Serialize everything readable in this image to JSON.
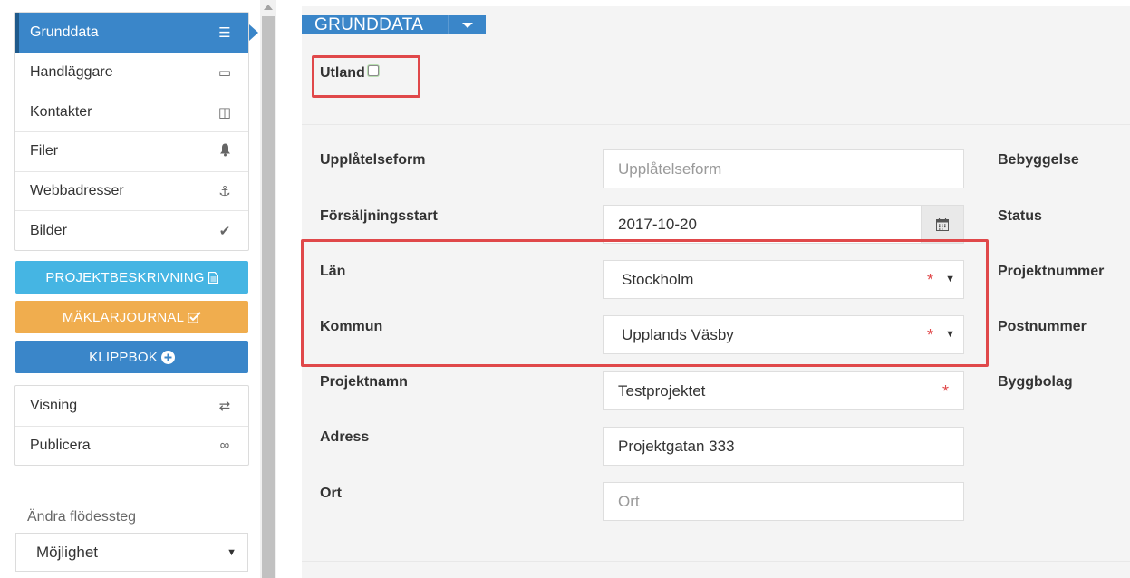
{
  "sidebar": {
    "items": [
      {
        "label": "Grunddata",
        "icon": "list-icon",
        "glyph": "☰"
      },
      {
        "label": "Handläggare",
        "icon": "laptop-icon",
        "glyph": "▭"
      },
      {
        "label": "Kontakter",
        "icon": "columns-icon",
        "glyph": "◫"
      },
      {
        "label": "Filer",
        "icon": "bell-icon",
        "glyph": "🔔"
      },
      {
        "label": "Webbadresser",
        "icon": "anchor-icon",
        "glyph": "⚓"
      },
      {
        "label": "Bilder",
        "icon": "check-icon",
        "glyph": "✔"
      }
    ],
    "buttons": {
      "projektbeskrivning": "PROJEKTBESKRIVNING",
      "maklarjournal": "MÄKLARJOURNAL",
      "klippbok": "KLIPPBOK"
    },
    "items2": [
      {
        "label": "Visning",
        "icon": "exchange-icon",
        "glyph": "⇄"
      },
      {
        "label": "Publicera",
        "icon": "link-icon",
        "glyph": "∞"
      }
    ],
    "flow_label": "Ändra flödessteg",
    "flow_value": "Möjlighet"
  },
  "main": {
    "section_title": "GRUNDDATA",
    "utland_label": "Utland",
    "fields": {
      "upplatelseform": {
        "label": "Upplåtelseform",
        "placeholder": "Upplåtelseform"
      },
      "forsaljningsstart": {
        "label": "Försäljningsstart",
        "value": "2017-10-20"
      },
      "lan": {
        "label": "Län",
        "value": "Stockholm",
        "required": "*"
      },
      "kommun": {
        "label": "Kommun",
        "value": "Upplands Väsby",
        "required": "*"
      },
      "projektnamn": {
        "label": "Projektnamn",
        "value": "Testprojektet",
        "required": "*"
      },
      "adress": {
        "label": "Adress",
        "value": "Projektgatan 333"
      },
      "ort": {
        "label": "Ort",
        "placeholder": "Ort"
      }
    },
    "right_labels": {
      "bebyggelse": "Bebyggelse",
      "status": "Status",
      "projektnummer": "Projektnummer",
      "postnummer": "Postnummer",
      "byggbolag": "Byggbolag"
    }
  },
  "colors": {
    "primary": "#3a86c9",
    "info": "#45b5e3",
    "warning": "#f0ad4e",
    "highlight": "#e0484a"
  }
}
